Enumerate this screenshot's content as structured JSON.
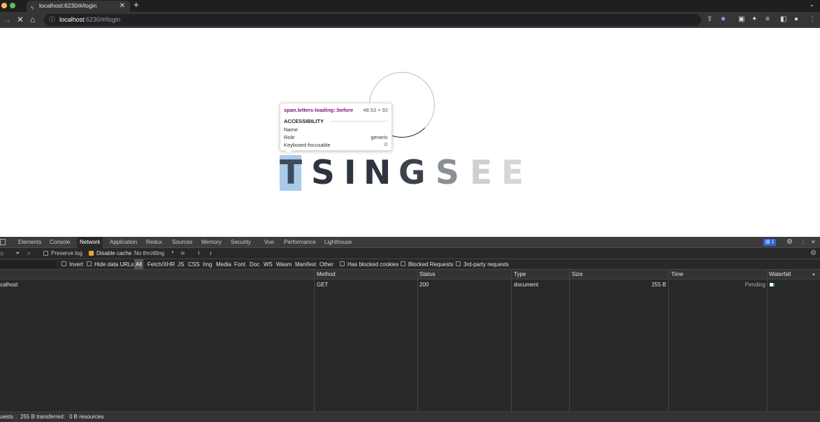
{
  "browser": {
    "tab_title": "localhost:6230/#/login",
    "tab_close": "✕",
    "new_tab": "+",
    "url_host": "localhost",
    "url_path": ":6230/#/login"
  },
  "tooltip": {
    "selector": "span.letters-loading::before",
    "dimensions": "48.53 × 92",
    "section": "ACCESSIBILITY",
    "rows": [
      {
        "key": "Name",
        "value": ""
      },
      {
        "key": "Role",
        "value": "generic"
      },
      {
        "key": "Keyboard-focusable",
        "value": "⊘"
      }
    ]
  },
  "loading_letters": [
    "T",
    "S",
    "I",
    "N",
    "G",
    "S",
    "E",
    "E"
  ],
  "devtools": {
    "tabs": [
      "Elements",
      "Console",
      "Network",
      "Application",
      "Redux",
      "Sources",
      "Memory",
      "Security",
      "Vue",
      "Performance",
      "Lighthouse"
    ],
    "active_tab": "Network",
    "issues_badge": "1",
    "toolbar": {
      "preserve_log": "Preserve log",
      "disable_cache": "Disable cache",
      "throttling": "No throttling"
    },
    "filters": {
      "invert": "Invert",
      "hide_data_urls": "Hide data URLs",
      "types": [
        "All",
        "Fetch/XHR",
        "JS",
        "CSS",
        "Img",
        "Media",
        "Font",
        "Doc",
        "WS",
        "Wasm",
        "Manifest",
        "Other"
      ],
      "has_blocked_cookies": "Has blocked cookies",
      "blocked_requests": "Blocked Requests",
      "third_party": "3rd-party requests"
    },
    "columns": [
      "Method",
      "Status",
      "Type",
      "Size",
      "Time",
      "Waterfall"
    ],
    "rows": [
      {
        "name": "calhost",
        "method": "GET",
        "status": "200",
        "type": "document",
        "size": "255 B",
        "time": "Pending"
      }
    ],
    "status_bar": {
      "requests": "uests",
      "transferred": "255 B transferred",
      "resources": "0 B resources"
    }
  },
  "colors": {
    "accent_checkbox": "#e8a33d",
    "highlight": "#6fa8dc",
    "badge": "#3367d6"
  }
}
